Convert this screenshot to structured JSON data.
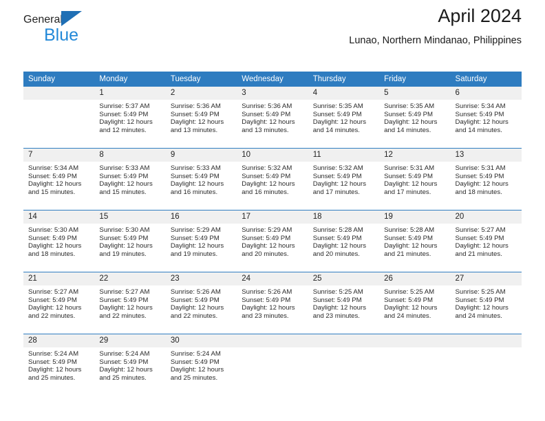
{
  "brand": {
    "name_top": "General",
    "name_bottom": "Blue",
    "accent_color": "#2389d8",
    "triangle_color": "#1f6fb5"
  },
  "header": {
    "title": "April 2024",
    "subtitle": "Lunao, Northern Mindanao, Philippines"
  },
  "calendar": {
    "header_bg": "#2e7cc0",
    "daynum_bg": "#f0f0f0",
    "weekdays": [
      "Sunday",
      "Monday",
      "Tuesday",
      "Wednesday",
      "Thursday",
      "Friday",
      "Saturday"
    ],
    "weeks": [
      [
        {
          "day": "",
          "sunrise": "",
          "sunset": "",
          "daylight1": "",
          "daylight2": ""
        },
        {
          "day": "1",
          "sunrise": "Sunrise: 5:37 AM",
          "sunset": "Sunset: 5:49 PM",
          "daylight1": "Daylight: 12 hours",
          "daylight2": "and 12 minutes."
        },
        {
          "day": "2",
          "sunrise": "Sunrise: 5:36 AM",
          "sunset": "Sunset: 5:49 PM",
          "daylight1": "Daylight: 12 hours",
          "daylight2": "and 13 minutes."
        },
        {
          "day": "3",
          "sunrise": "Sunrise: 5:36 AM",
          "sunset": "Sunset: 5:49 PM",
          "daylight1": "Daylight: 12 hours",
          "daylight2": "and 13 minutes."
        },
        {
          "day": "4",
          "sunrise": "Sunrise: 5:35 AM",
          "sunset": "Sunset: 5:49 PM",
          "daylight1": "Daylight: 12 hours",
          "daylight2": "and 14 minutes."
        },
        {
          "day": "5",
          "sunrise": "Sunrise: 5:35 AM",
          "sunset": "Sunset: 5:49 PM",
          "daylight1": "Daylight: 12 hours",
          "daylight2": "and 14 minutes."
        },
        {
          "day": "6",
          "sunrise": "Sunrise: 5:34 AM",
          "sunset": "Sunset: 5:49 PM",
          "daylight1": "Daylight: 12 hours",
          "daylight2": "and 14 minutes."
        }
      ],
      [
        {
          "day": "7",
          "sunrise": "Sunrise: 5:34 AM",
          "sunset": "Sunset: 5:49 PM",
          "daylight1": "Daylight: 12 hours",
          "daylight2": "and 15 minutes."
        },
        {
          "day": "8",
          "sunrise": "Sunrise: 5:33 AM",
          "sunset": "Sunset: 5:49 PM",
          "daylight1": "Daylight: 12 hours",
          "daylight2": "and 15 minutes."
        },
        {
          "day": "9",
          "sunrise": "Sunrise: 5:33 AM",
          "sunset": "Sunset: 5:49 PM",
          "daylight1": "Daylight: 12 hours",
          "daylight2": "and 16 minutes."
        },
        {
          "day": "10",
          "sunrise": "Sunrise: 5:32 AM",
          "sunset": "Sunset: 5:49 PM",
          "daylight1": "Daylight: 12 hours",
          "daylight2": "and 16 minutes."
        },
        {
          "day": "11",
          "sunrise": "Sunrise: 5:32 AM",
          "sunset": "Sunset: 5:49 PM",
          "daylight1": "Daylight: 12 hours",
          "daylight2": "and 17 minutes."
        },
        {
          "day": "12",
          "sunrise": "Sunrise: 5:31 AM",
          "sunset": "Sunset: 5:49 PM",
          "daylight1": "Daylight: 12 hours",
          "daylight2": "and 17 minutes."
        },
        {
          "day": "13",
          "sunrise": "Sunrise: 5:31 AM",
          "sunset": "Sunset: 5:49 PM",
          "daylight1": "Daylight: 12 hours",
          "daylight2": "and 18 minutes."
        }
      ],
      [
        {
          "day": "14",
          "sunrise": "Sunrise: 5:30 AM",
          "sunset": "Sunset: 5:49 PM",
          "daylight1": "Daylight: 12 hours",
          "daylight2": "and 18 minutes."
        },
        {
          "day": "15",
          "sunrise": "Sunrise: 5:30 AM",
          "sunset": "Sunset: 5:49 PM",
          "daylight1": "Daylight: 12 hours",
          "daylight2": "and 19 minutes."
        },
        {
          "day": "16",
          "sunrise": "Sunrise: 5:29 AM",
          "sunset": "Sunset: 5:49 PM",
          "daylight1": "Daylight: 12 hours",
          "daylight2": "and 19 minutes."
        },
        {
          "day": "17",
          "sunrise": "Sunrise: 5:29 AM",
          "sunset": "Sunset: 5:49 PM",
          "daylight1": "Daylight: 12 hours",
          "daylight2": "and 20 minutes."
        },
        {
          "day": "18",
          "sunrise": "Sunrise: 5:28 AM",
          "sunset": "Sunset: 5:49 PM",
          "daylight1": "Daylight: 12 hours",
          "daylight2": "and 20 minutes."
        },
        {
          "day": "19",
          "sunrise": "Sunrise: 5:28 AM",
          "sunset": "Sunset: 5:49 PM",
          "daylight1": "Daylight: 12 hours",
          "daylight2": "and 21 minutes."
        },
        {
          "day": "20",
          "sunrise": "Sunrise: 5:27 AM",
          "sunset": "Sunset: 5:49 PM",
          "daylight1": "Daylight: 12 hours",
          "daylight2": "and 21 minutes."
        }
      ],
      [
        {
          "day": "21",
          "sunrise": "Sunrise: 5:27 AM",
          "sunset": "Sunset: 5:49 PM",
          "daylight1": "Daylight: 12 hours",
          "daylight2": "and 22 minutes."
        },
        {
          "day": "22",
          "sunrise": "Sunrise: 5:27 AM",
          "sunset": "Sunset: 5:49 PM",
          "daylight1": "Daylight: 12 hours",
          "daylight2": "and 22 minutes."
        },
        {
          "day": "23",
          "sunrise": "Sunrise: 5:26 AM",
          "sunset": "Sunset: 5:49 PM",
          "daylight1": "Daylight: 12 hours",
          "daylight2": "and 22 minutes."
        },
        {
          "day": "24",
          "sunrise": "Sunrise: 5:26 AM",
          "sunset": "Sunset: 5:49 PM",
          "daylight1": "Daylight: 12 hours",
          "daylight2": "and 23 minutes."
        },
        {
          "day": "25",
          "sunrise": "Sunrise: 5:25 AM",
          "sunset": "Sunset: 5:49 PM",
          "daylight1": "Daylight: 12 hours",
          "daylight2": "and 23 minutes."
        },
        {
          "day": "26",
          "sunrise": "Sunrise: 5:25 AM",
          "sunset": "Sunset: 5:49 PM",
          "daylight1": "Daylight: 12 hours",
          "daylight2": "and 24 minutes."
        },
        {
          "day": "27",
          "sunrise": "Sunrise: 5:25 AM",
          "sunset": "Sunset: 5:49 PM",
          "daylight1": "Daylight: 12 hours",
          "daylight2": "and 24 minutes."
        }
      ],
      [
        {
          "day": "28",
          "sunrise": "Sunrise: 5:24 AM",
          "sunset": "Sunset: 5:49 PM",
          "daylight1": "Daylight: 12 hours",
          "daylight2": "and 25 minutes."
        },
        {
          "day": "29",
          "sunrise": "Sunrise: 5:24 AM",
          "sunset": "Sunset: 5:49 PM",
          "daylight1": "Daylight: 12 hours",
          "daylight2": "and 25 minutes."
        },
        {
          "day": "30",
          "sunrise": "Sunrise: 5:24 AM",
          "sunset": "Sunset: 5:49 PM",
          "daylight1": "Daylight: 12 hours",
          "daylight2": "and 25 minutes."
        },
        {
          "day": "",
          "sunrise": "",
          "sunset": "",
          "daylight1": "",
          "daylight2": ""
        },
        {
          "day": "",
          "sunrise": "",
          "sunset": "",
          "daylight1": "",
          "daylight2": ""
        },
        {
          "day": "",
          "sunrise": "",
          "sunset": "",
          "daylight1": "",
          "daylight2": ""
        },
        {
          "day": "",
          "sunrise": "",
          "sunset": "",
          "daylight1": "",
          "daylight2": ""
        }
      ]
    ]
  }
}
